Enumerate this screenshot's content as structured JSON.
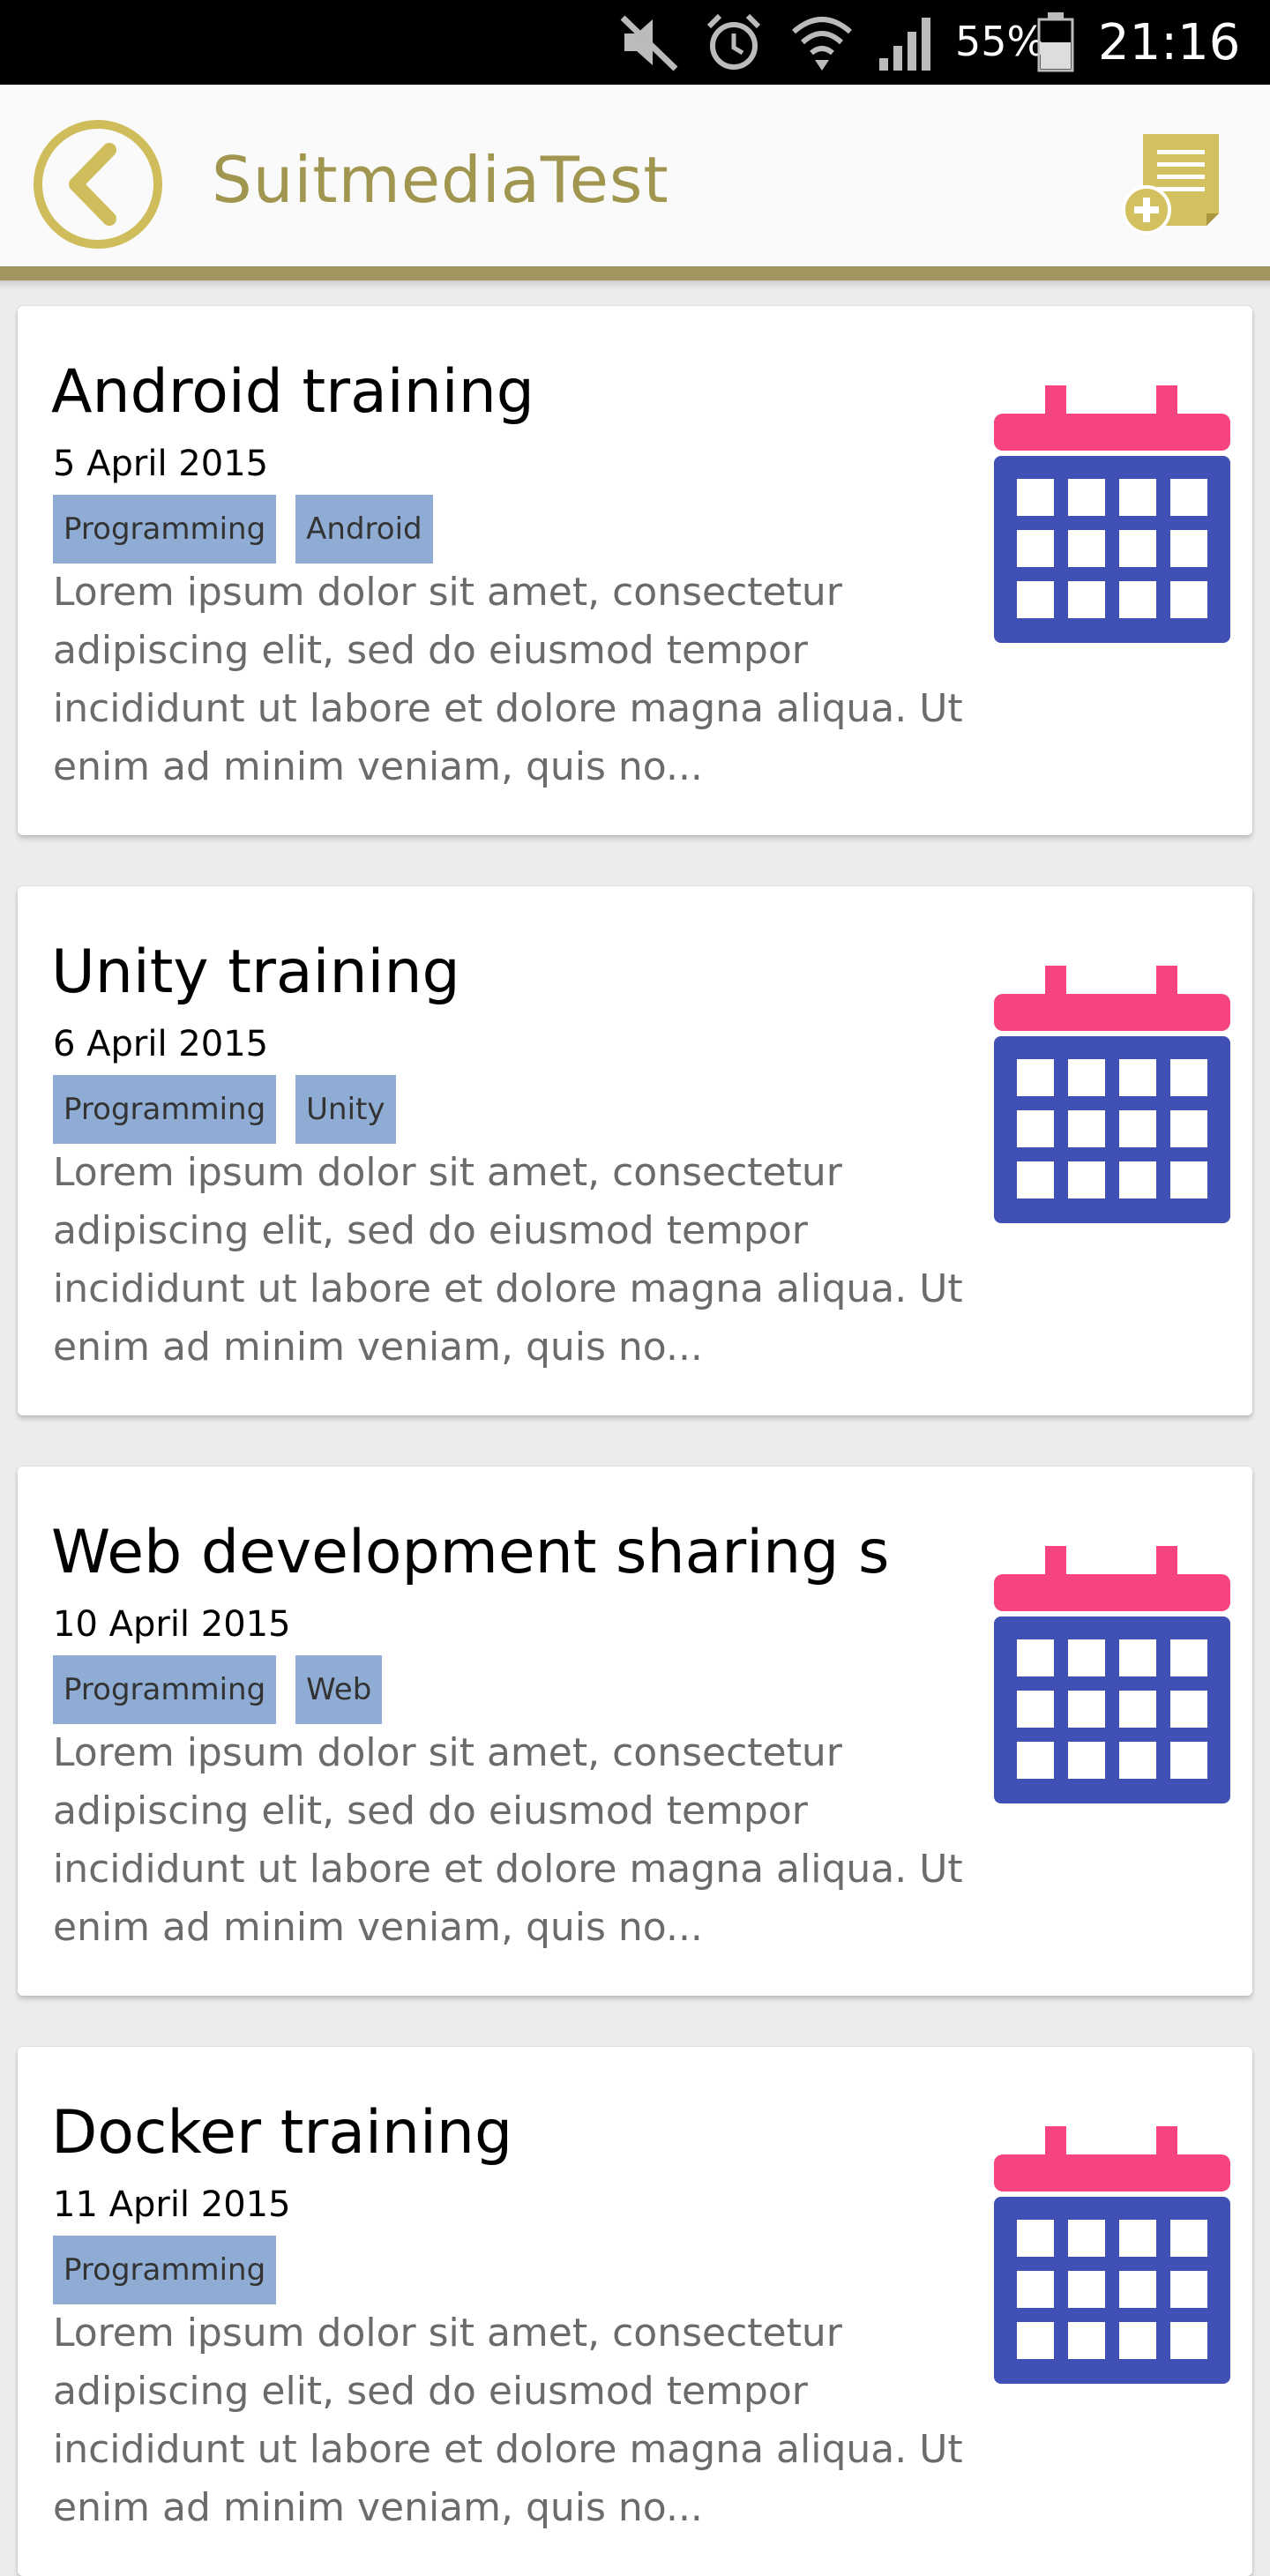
{
  "status_bar": {
    "battery_percent": "55%",
    "time": "21:16",
    "icons": [
      "mute-icon",
      "alarm-icon",
      "wifi-icon",
      "signal-icon",
      "battery-icon"
    ]
  },
  "app_bar": {
    "title": "SuitmediaTest",
    "back_icon": "back-arrow-icon",
    "add_icon": "add-document-icon",
    "accent_color": "#a19660"
  },
  "events": [
    {
      "title": "Android training",
      "date": "5 April 2015",
      "tags": [
        "Programming",
        "Android"
      ],
      "description": "Lorem ipsum dolor sit amet, consectetur adipiscing elit, sed do eiusmod tempor incididunt ut labore et dolore magna aliqua. Ut enim ad minim veniam, quis no..."
    },
    {
      "title": "Unity training",
      "date": "6 April 2015",
      "tags": [
        "Programming",
        "Unity"
      ],
      "description": "Lorem ipsum dolor sit amet, consectetur adipiscing elit, sed do eiusmod tempor incididunt ut labore et dolore magna aliqua. Ut enim ad minim veniam, quis no..."
    },
    {
      "title": "Web development sharing s",
      "date": "10 April 2015",
      "tags": [
        "Programming",
        "Web"
      ],
      "description": "Lorem ipsum dolor sit amet, consectetur adipiscing elit, sed do eiusmod tempor incididunt ut labore et dolore magna aliqua. Ut enim ad minim veniam, quis no..."
    },
    {
      "title": "Docker training",
      "date": "11 April 2015",
      "tags": [
        "Programming"
      ],
      "description": "Lorem ipsum dolor sit amet, consectetur adipiscing elit, sed do eiusmod tempor incididunt ut labore et dolore magna aliqua. Ut enim ad minim veniam, quis no..."
    }
  ],
  "colors": {
    "tag_bg": "#8fadd4",
    "calendar_top": "#f6447f",
    "calendar_body": "#4050b5"
  }
}
